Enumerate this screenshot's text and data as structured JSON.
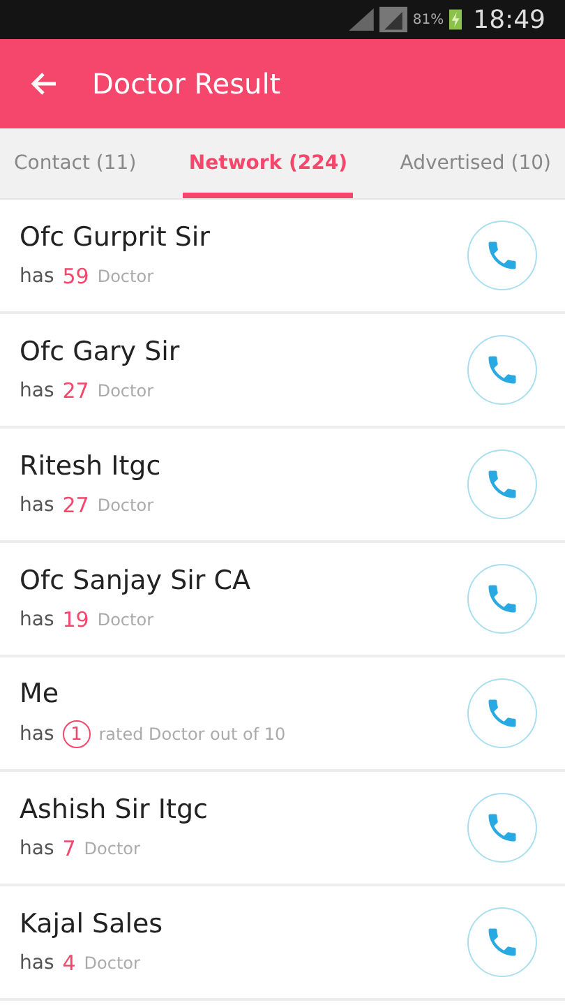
{
  "status_bar": {
    "battery": "81%",
    "time": "18:49"
  },
  "header": {
    "title": "Doctor Result"
  },
  "tabs": [
    {
      "label": "Contact (11)",
      "selected": false
    },
    {
      "label": "Network (224)",
      "selected": true
    },
    {
      "label": "Advertised (10)",
      "selected": false
    }
  ],
  "rows": [
    {
      "name": "Ofc Gurprit Sir",
      "prefix": "has",
      "count": "59",
      "suffix": "Doctor",
      "kind": "count"
    },
    {
      "name": "Ofc Gary Sir",
      "prefix": "has",
      "count": "27",
      "suffix": "Doctor",
      "kind": "count"
    },
    {
      "name": "Ritesh Itgc",
      "prefix": "has",
      "count": "27",
      "suffix": "Doctor",
      "kind": "count"
    },
    {
      "name": "Ofc Sanjay Sir CA",
      "prefix": "has",
      "count": "19",
      "suffix": "Doctor",
      "kind": "count"
    },
    {
      "name": "Me",
      "prefix": "has",
      "count": "1",
      "suffix": "rated Doctor out of 10",
      "kind": "circled"
    },
    {
      "name": "Ashish Sir Itgc",
      "prefix": "has",
      "count": "7",
      "suffix": "Doctor",
      "kind": "count"
    },
    {
      "name": "Kajal Sales",
      "prefix": "has",
      "count": "4",
      "suffix": "Doctor",
      "kind": "count"
    }
  ]
}
